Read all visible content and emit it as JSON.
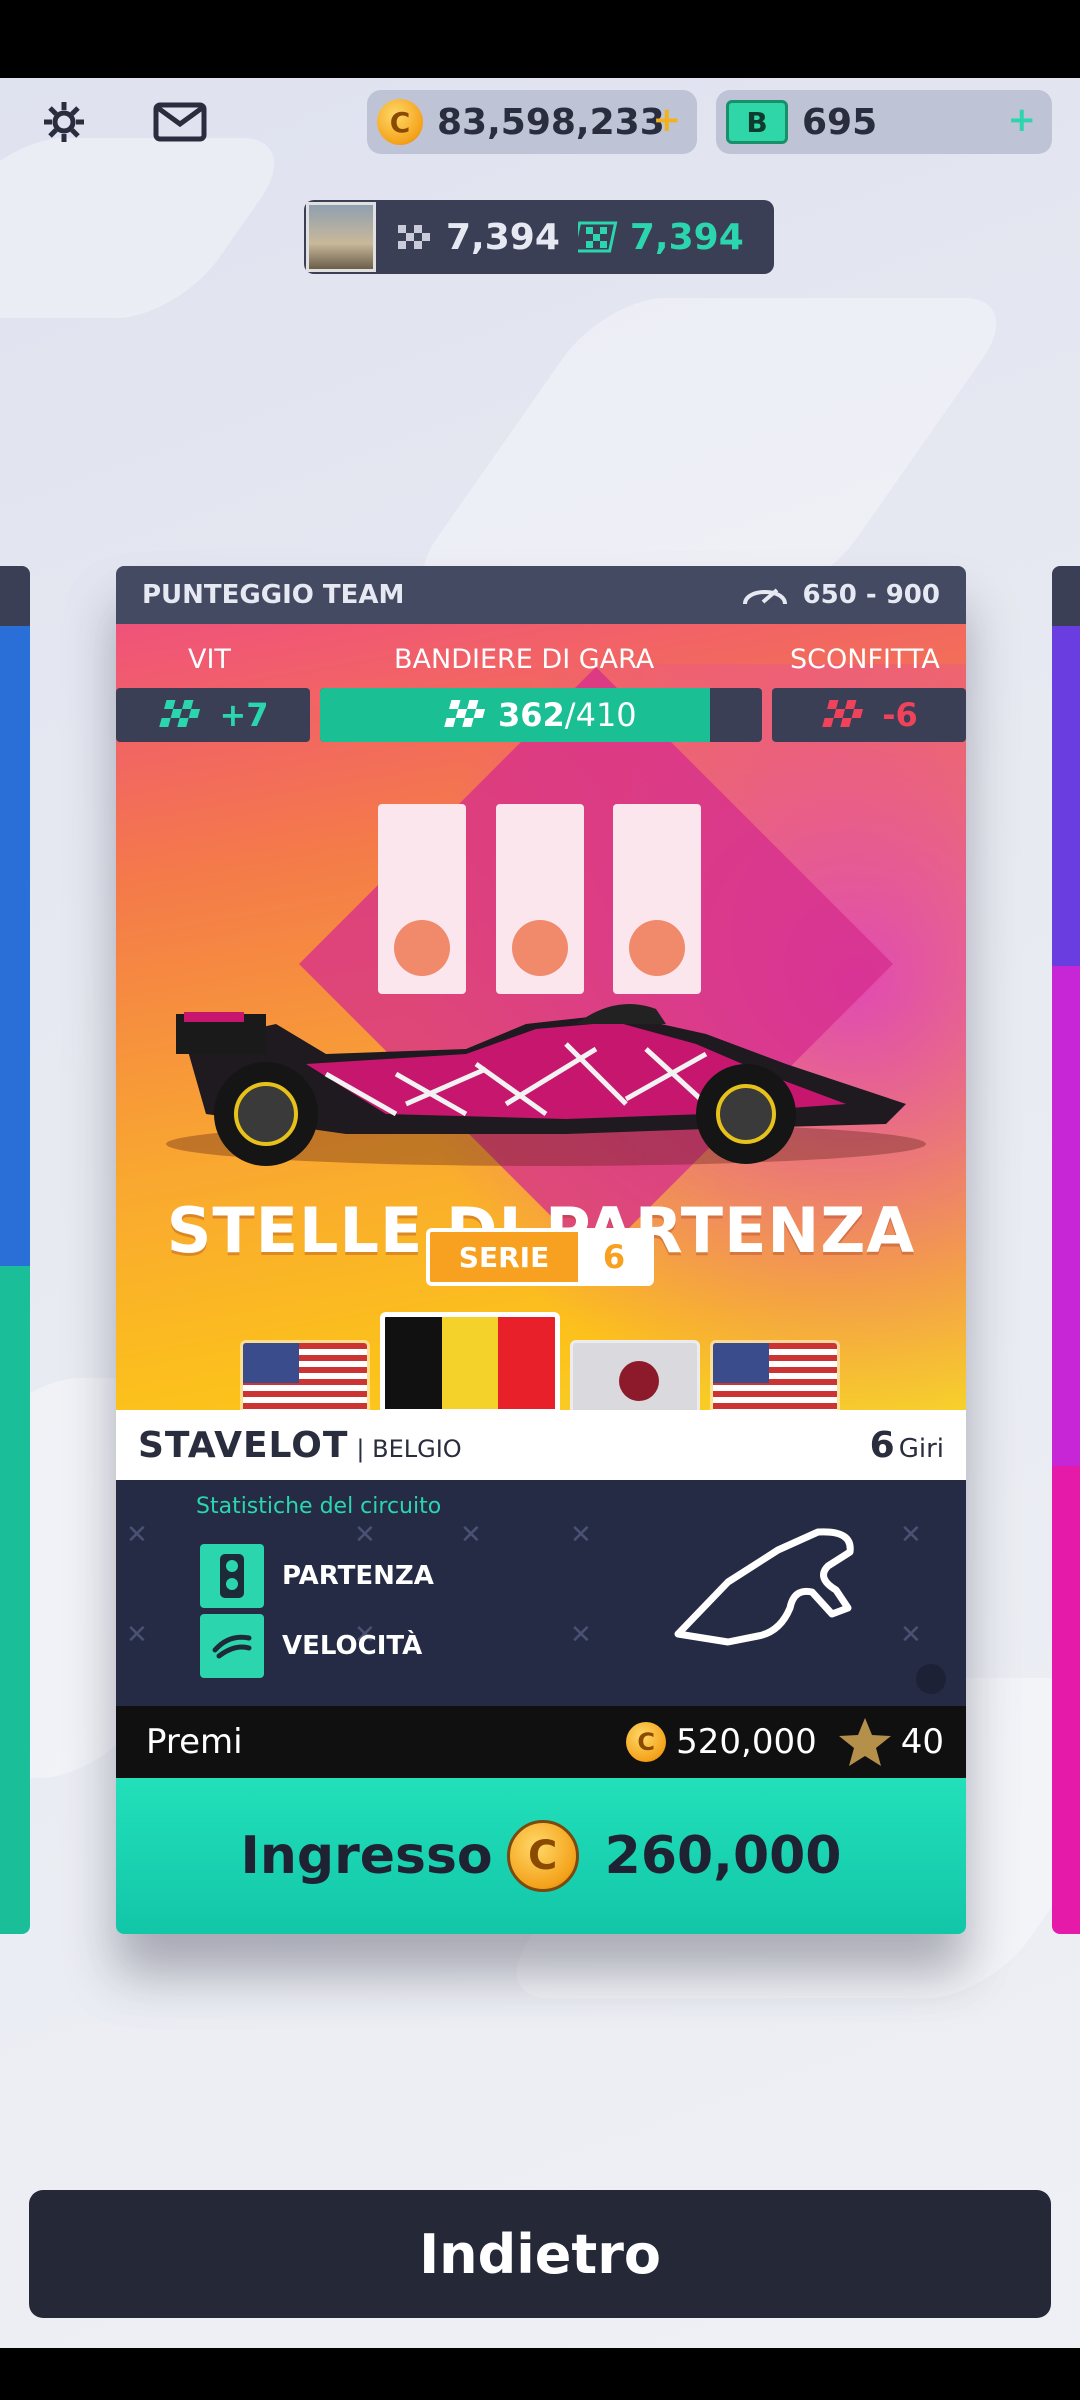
{
  "topbar": {
    "coins": "83,598,233",
    "bucks": "695",
    "bucks_badge": "B"
  },
  "profile": {
    "score_a": "7,394",
    "score_b": "7,394"
  },
  "card": {
    "team_score_label": "PUNTEGGIO TEAM",
    "team_score_range": "650 - 900",
    "win_label": "VIT",
    "flags_label": "BANDIERE DI GARA",
    "loss_label": "SCONFITTA",
    "win_value": "+7",
    "flags_current": "362",
    "flags_total": "/410",
    "flags_progress": 0.883,
    "loss_value": "-6",
    "event_title": "STELLE DI PARTENZA",
    "series_label": "SERIE",
    "series_number": "6",
    "circuit": "STAVELOT",
    "country": "| BELGIO",
    "laps": "6",
    "laps_label": "Giri",
    "stats_title": "Statistiche del circuito",
    "stat1": "PARTENZA",
    "stat2": "VELOCITÀ",
    "prizes_label": "Premi",
    "prize_coins": "520,000",
    "prize_stars": "40",
    "entry_label": "Ingresso",
    "entry_cost": "260,000"
  },
  "buttons": {
    "back": "Indietro"
  },
  "colors": {
    "accent": "#22e0ba",
    "win": "#2bd6ae",
    "loss": "#f0425a"
  }
}
